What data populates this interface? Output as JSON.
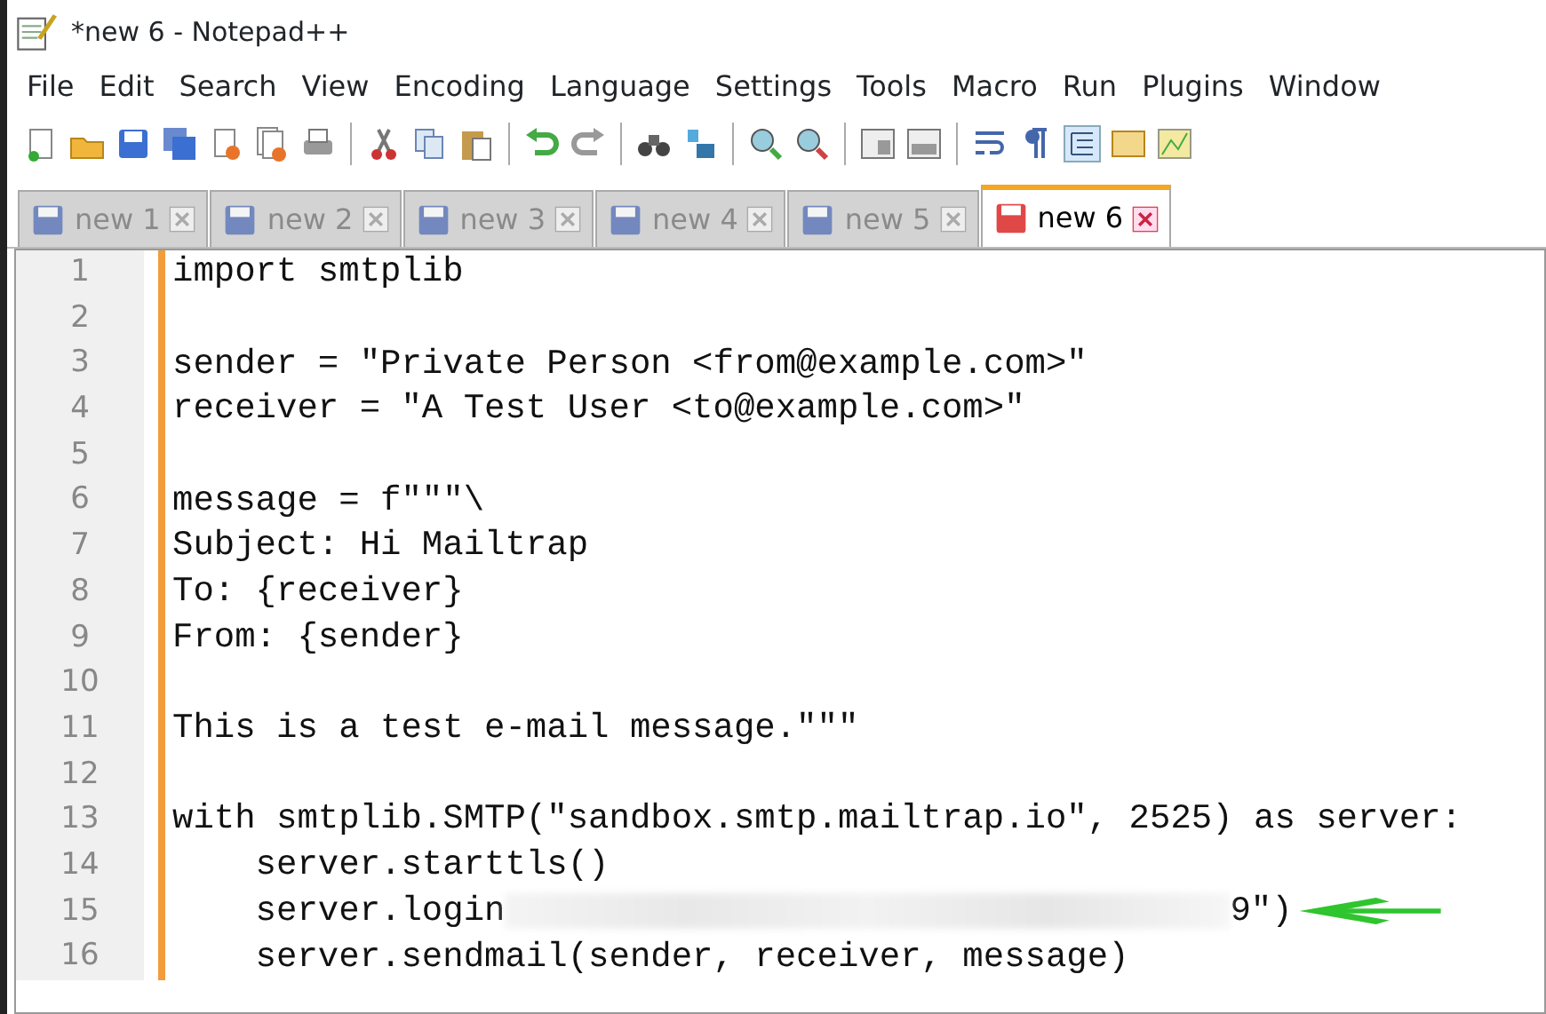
{
  "window": {
    "title": "*new 6 - Notepad++"
  },
  "menu": [
    "File",
    "Edit",
    "Search",
    "View",
    "Encoding",
    "Language",
    "Settings",
    "Tools",
    "Macro",
    "Run",
    "Plugins",
    "Window"
  ],
  "tabs": [
    {
      "label": "new 1",
      "selected": false,
      "modified": false
    },
    {
      "label": "new 2",
      "selected": false,
      "modified": false
    },
    {
      "label": "new 3",
      "selected": false,
      "modified": false
    },
    {
      "label": "new 4",
      "selected": false,
      "modified": false
    },
    {
      "label": "new 5",
      "selected": false,
      "modified": false
    },
    {
      "label": "new 6",
      "selected": true,
      "modified": true
    }
  ],
  "editor": {
    "lines": [
      {
        "number": "1",
        "text": "import smtplib"
      },
      {
        "number": "2"
      },
      {
        "number": "3",
        "text": "sender = \"Private Person <from@example.com>\""
      },
      {
        "number": "4",
        "text": "receiver = \"A Test User <to@example.com>\""
      },
      {
        "number": "5"
      },
      {
        "number": "6",
        "text": "message = f\"\"\"\\"
      },
      {
        "number": "7",
        "text": "Subject: Hi Mailtrap"
      },
      {
        "number": "8",
        "text": "To: {receiver}"
      },
      {
        "number": "9",
        "text": "From: {sender}"
      },
      {
        "number": "10"
      },
      {
        "number": "11",
        "text": "This is a test e-mail message.\"\"\""
      },
      {
        "number": "12"
      },
      {
        "number": "13",
        "text": "with smtplib.SMTP(\"sandbox.smtp.mailtrap.io\", 2525) as server:"
      },
      {
        "number": "14",
        "text": "    server.starttls()"
      },
      {
        "number": "15",
        "text": "    server.login",
        "redacted": true,
        "tail": "9\")",
        "annotated": true
      },
      {
        "number": "16",
        "text": "    server.sendmail(sender, receiver, message)"
      }
    ]
  }
}
